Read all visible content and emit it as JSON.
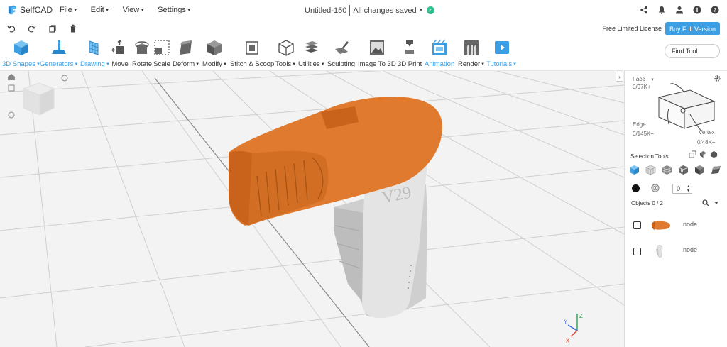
{
  "app": {
    "name": "SelfCAD",
    "doc_title": "Untitled-150",
    "save_status": "All changes saved"
  },
  "menu": {
    "items": [
      "File",
      "Edit",
      "View",
      "Settings"
    ]
  },
  "license": {
    "text": "Free Limited License",
    "buy_label": "Buy Full Version"
  },
  "toolbar": {
    "items": [
      {
        "label": "3D Shapes",
        "dropdown": true,
        "active": true
      },
      {
        "label": "Generators",
        "dropdown": true,
        "active": true
      },
      {
        "label": "Drawing",
        "dropdown": true,
        "active": true
      },
      {
        "label": "Move",
        "dropdown": false
      },
      {
        "label": "Rotate",
        "dropdown": false
      },
      {
        "label": "Scale",
        "dropdown": false
      },
      {
        "label": "Deform",
        "dropdown": true
      },
      {
        "label": "Modify",
        "dropdown": true
      },
      {
        "label": "Stitch & Scoop",
        "dropdown": false
      },
      {
        "label": "Tools",
        "dropdown": true
      },
      {
        "label": "Utilities",
        "dropdown": true
      },
      {
        "label": "Sculpting",
        "dropdown": false
      },
      {
        "label": "Image To 3D",
        "dropdown": false
      },
      {
        "label": "3D Print",
        "dropdown": false
      },
      {
        "label": "Animation",
        "dropdown": false,
        "active": true
      },
      {
        "label": "Render",
        "dropdown": true
      },
      {
        "label": "Tutorials",
        "dropdown": true,
        "active": true
      }
    ],
    "find_tool": "Find Tool"
  },
  "viewport": {
    "model_text": "V29",
    "axis_labels": [
      "X",
      "Y",
      "Z"
    ]
  },
  "panel": {
    "face_label": "Face",
    "face_count": "0/97K+",
    "edge_label": "Edge",
    "edge_count": "0/145K+",
    "vertex_label": "Vertex",
    "vertex_count": "0/48K+",
    "selection_tools_title": "Selection Tools",
    "brush_value": "0",
    "objects_title": "Objects 0 / 2",
    "objects": [
      {
        "name": "node",
        "color": "#e07a2e"
      },
      {
        "name": "node",
        "color": "#d9d9d9"
      }
    ]
  },
  "colors": {
    "accent": "#3c9fe4",
    "model_orange": "#e07a2e",
    "model_white": "#e2e2e2",
    "saved_green": "#2fbf8f"
  }
}
